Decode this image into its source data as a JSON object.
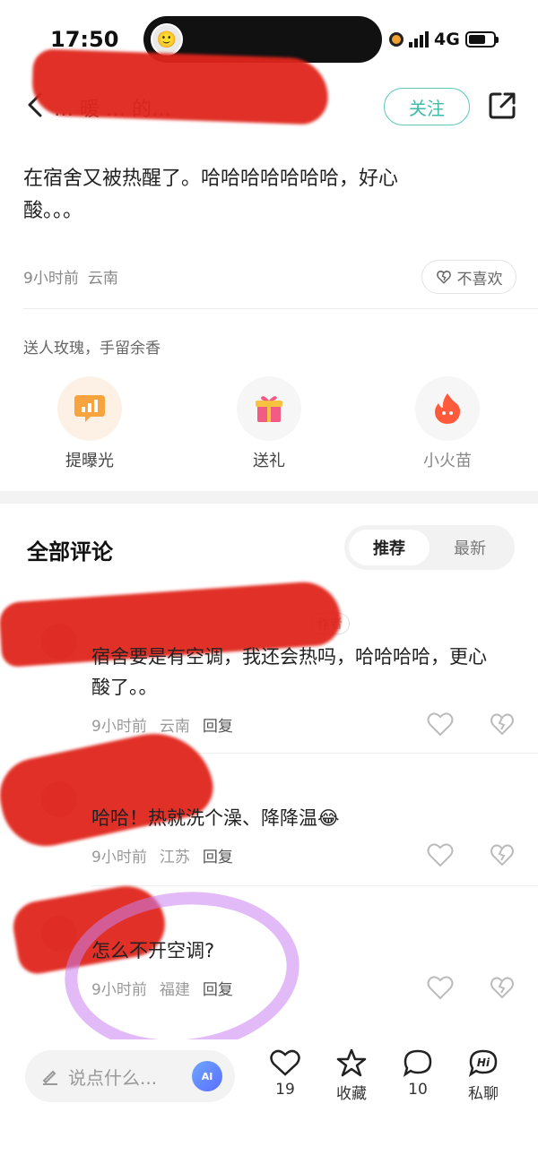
{
  "status": {
    "time": "17:50",
    "network": "4G"
  },
  "header": {
    "title": "… 暖 … 的…",
    "follow_label": "关注"
  },
  "post": {
    "text": "在宿舍又被热醒了。哈哈哈哈哈哈哈，好心酸。。。",
    "time_ago": "9小时前",
    "location": "云南",
    "dislike_label": "不喜欢"
  },
  "gifts": {
    "hint": "送人玫瑰，手留余香",
    "items": [
      {
        "label": "提曝光"
      },
      {
        "label": "送礼"
      },
      {
        "label": "小火苗"
      }
    ]
  },
  "comments_section": {
    "title": "全部评论",
    "tabs": [
      {
        "label": "推荐"
      },
      {
        "label": "最新"
      }
    ]
  },
  "comments": [
    {
      "badge": "作者",
      "text": "宿舍要是有空调，我还会热吗，哈哈哈哈，更心酸了。。",
      "time_ago": "9小时前",
      "location": "云南",
      "reply": "回复"
    },
    {
      "text": "哈哈！热就洗个澡、降降温😂",
      "time_ago": "9小时前",
      "location": "江苏",
      "reply": "回复"
    },
    {
      "text": "怎么不开空调?",
      "time_ago": "9小时前",
      "location": "福建",
      "reply": "回复"
    }
  ],
  "bottom_bar": {
    "input_placeholder": "说点什么...",
    "ai_label": "AI",
    "likes": "19",
    "favorite_label": "收藏",
    "comments_count": "10",
    "message_label": "私聊",
    "message_icon_text": "Hi"
  }
}
